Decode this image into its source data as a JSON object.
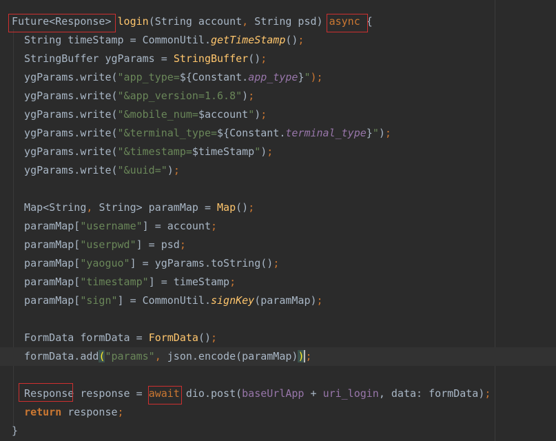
{
  "editor": {
    "language": "dart",
    "lines": [
      [
        [
          "Future<Response>",
          "c-default"
        ],
        [
          " ",
          "c-default"
        ],
        [
          "login",
          "c-fn"
        ],
        [
          "(String account",
          "c-default"
        ],
        [
          ", ",
          "c-kw"
        ],
        [
          "String psd) ",
          "c-default"
        ],
        [
          "async",
          "c-kw"
        ],
        [
          " {",
          "c-brace"
        ]
      ],
      [
        [
          "  String timeStamp = CommonUtil.",
          "c-default"
        ],
        [
          "getTimeStamp",
          "c-static-i"
        ],
        [
          "()",
          "c-default"
        ],
        [
          ";",
          "c-kw"
        ]
      ],
      [
        [
          "  StringBuffer ygParams = ",
          "c-default"
        ],
        [
          "StringBuffer",
          "c-fn"
        ],
        [
          "()",
          "c-default"
        ],
        [
          ";",
          "c-kw"
        ]
      ],
      [
        [
          "  ygParams.write(",
          "c-default"
        ],
        [
          "\"app_type=",
          "c-str"
        ],
        [
          "${",
          "c-default"
        ],
        [
          "Constant.",
          "c-default"
        ],
        [
          "app_type",
          "c-const"
        ],
        [
          "}",
          "c-default"
        ],
        [
          "\"",
          "c-str"
        ],
        [
          ");",
          "c-kw"
        ]
      ],
      [
        [
          "  ygParams.write(",
          "c-default"
        ],
        [
          "\"&app_version=",
          "c-str"
        ],
        [
          "1.6.8",
          "c-str"
        ],
        [
          "\"",
          "c-str"
        ],
        [
          ")",
          "c-default"
        ],
        [
          ";",
          "c-kw"
        ]
      ],
      [
        [
          "  ygParams.write(",
          "c-default"
        ],
        [
          "\"&mobile_num=",
          "c-str"
        ],
        [
          "$account",
          "c-default"
        ],
        [
          "\"",
          "c-str"
        ],
        [
          ")",
          "c-default"
        ],
        [
          ";",
          "c-kw"
        ]
      ],
      [
        [
          "  ygParams.write(",
          "c-default"
        ],
        [
          "\"&terminal_type=",
          "c-str"
        ],
        [
          "${",
          "c-default"
        ],
        [
          "Constant.",
          "c-default"
        ],
        [
          "terminal_type",
          "c-const"
        ],
        [
          "}",
          "c-default"
        ],
        [
          "\"",
          "c-str"
        ],
        [
          ")",
          "c-default"
        ],
        [
          ";",
          "c-kw"
        ]
      ],
      [
        [
          "  ygParams.write(",
          "c-default"
        ],
        [
          "\"&timestamp=",
          "c-str"
        ],
        [
          "$timeStamp",
          "c-default"
        ],
        [
          "\"",
          "c-str"
        ],
        [
          ")",
          "c-default"
        ],
        [
          ";",
          "c-kw"
        ]
      ],
      [
        [
          "  ygParams.write(",
          "c-default"
        ],
        [
          "\"&uuid=\"",
          "c-str"
        ],
        [
          ")",
          "c-default"
        ],
        [
          ";",
          "c-kw"
        ]
      ],
      [
        [
          "",
          "c-default"
        ]
      ],
      [
        [
          "  Map<String",
          "c-default"
        ],
        [
          ", ",
          "c-kw"
        ],
        [
          "String> paramMap = ",
          "c-default"
        ],
        [
          "Map",
          "c-fn"
        ],
        [
          "()",
          "c-default"
        ],
        [
          ";",
          "c-kw"
        ]
      ],
      [
        [
          "  paramMap[",
          "c-default"
        ],
        [
          "\"username\"",
          "c-str"
        ],
        [
          "] = account",
          "c-default"
        ],
        [
          ";",
          "c-kw"
        ]
      ],
      [
        [
          "  paramMap[",
          "c-default"
        ],
        [
          "\"userpwd\"",
          "c-str"
        ],
        [
          "] = psd",
          "c-default"
        ],
        [
          ";",
          "c-kw"
        ]
      ],
      [
        [
          "  paramMap[",
          "c-default"
        ],
        [
          "\"yaoguo\"",
          "c-str"
        ],
        [
          "] = ygParams.toString()",
          "c-default"
        ],
        [
          ";",
          "c-kw"
        ]
      ],
      [
        [
          "  paramMap[",
          "c-default"
        ],
        [
          "\"timestamp\"",
          "c-str"
        ],
        [
          "] = timeStamp",
          "c-default"
        ],
        [
          ";",
          "c-kw"
        ]
      ],
      [
        [
          "  paramMap[",
          "c-default"
        ],
        [
          "\"sign\"",
          "c-str"
        ],
        [
          "] = CommonUtil.",
          "c-default"
        ],
        [
          "signKey",
          "c-static-i"
        ],
        [
          "(paramMap)",
          "c-default"
        ],
        [
          ";",
          "c-kw"
        ]
      ],
      [
        [
          "",
          "c-default"
        ]
      ],
      [
        [
          "  FormData formData = ",
          "c-default"
        ],
        [
          "FormData",
          "c-fn"
        ],
        [
          "()",
          "c-default"
        ],
        [
          ";",
          "c-kw"
        ]
      ],
      [
        [
          "  formData.add",
          "c-default"
        ],
        [
          "(",
          "c-brace-match"
        ],
        [
          "\"params\"",
          "c-str"
        ],
        [
          ", ",
          "c-kw"
        ],
        [
          "json.encode(paramMap)",
          "c-default"
        ],
        [
          ")",
          "c-brace-match"
        ],
        [
          ";",
          "c-kw c-caret"
        ]
      ],
      [
        [
          "",
          "c-default"
        ]
      ],
      [
        [
          "  Response response = ",
          "c-default"
        ],
        [
          "await",
          "c-kw"
        ],
        [
          " dio.post(",
          "c-default"
        ],
        [
          "baseUrlApp",
          "c-field"
        ],
        [
          " + ",
          "c-default"
        ],
        [
          "uri_login",
          "c-field"
        ],
        [
          ", data: formData)",
          "c-default"
        ],
        [
          ";",
          "c-kw"
        ]
      ],
      [
        [
          "  ",
          "c-default"
        ],
        [
          "return",
          "c-kwb"
        ],
        [
          " response",
          "c-default"
        ],
        [
          ";",
          "c-kw"
        ]
      ],
      [
        [
          "}",
          "c-brace"
        ]
      ]
    ]
  }
}
